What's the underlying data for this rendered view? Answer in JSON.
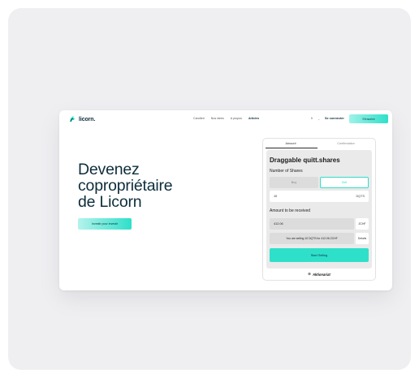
{
  "header": {
    "logo_text": "licorn.",
    "nav": [
      "Carotteri",
      "Nos idees",
      "A propos",
      "Articles"
    ],
    "lang": "fr",
    "login": "Se connecter",
    "signup": "S'inscrire"
  },
  "hero": {
    "title_lines": [
      "Devenez",
      "copropriétaire",
      "de Licorn"
    ],
    "button": "Investir pour investir"
  },
  "widget": {
    "tabs": [
      "Amount",
      "Confirmation"
    ],
    "title": "Draggable quitt.shares",
    "shares_label": "Number of Shares",
    "buy_label": "Buy",
    "sell_label": "Sell",
    "quantity": "10",
    "quantity_unit": "DQTS",
    "amount_label": "Amount to be received",
    "amount": "412.06",
    "amount_unit": "ZCHF",
    "summary": "You are selling 10 DQTS for 412.06 ZCHF",
    "details": "Details",
    "cta": "Start Selling",
    "powered_by": "Aktionariat"
  },
  "colors": {
    "accent": "#2ee0c9",
    "brand_dark": "#0d2d3b"
  }
}
